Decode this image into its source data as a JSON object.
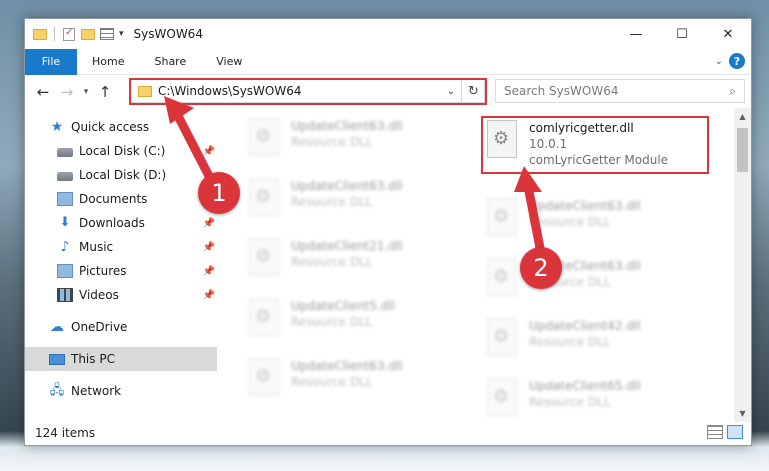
{
  "window": {
    "title": "SysWOW64",
    "controls": {
      "minimize": "—",
      "maximize": "☐",
      "close": "✕"
    }
  },
  "ribbon": {
    "tabs": [
      "File",
      "Home",
      "Share",
      "View"
    ]
  },
  "navigation": {
    "address": "C:\\Windows\\SysWOW64",
    "search_placeholder": "Search SysWOW64"
  },
  "sidebar": {
    "items": [
      {
        "label": "Quick access",
        "icon": "star-icon",
        "pinned": false
      },
      {
        "label": "Local Disk (C:)",
        "icon": "disk-icon",
        "pinned": true
      },
      {
        "label": "Local Disk (D:)",
        "icon": "disk-icon",
        "pinned": false
      },
      {
        "label": "Documents",
        "icon": "documents-icon",
        "pinned": true
      },
      {
        "label": "Downloads",
        "icon": "downloads-icon",
        "pinned": true
      },
      {
        "label": "Music",
        "icon": "music-icon",
        "pinned": true
      },
      {
        "label": "Pictures",
        "icon": "pictures-icon",
        "pinned": true
      },
      {
        "label": "Videos",
        "icon": "videos-icon",
        "pinned": true
      },
      {
        "label": "OneDrive",
        "icon": "onedrive-icon",
        "pinned": false
      },
      {
        "label": "This PC",
        "icon": "pc-icon",
        "pinned": false,
        "selected": true
      },
      {
        "label": "Network",
        "icon": "network-icon",
        "pinned": false
      }
    ]
  },
  "files": {
    "left_column": [
      {
        "name": "UpdateClient63.dll",
        "type": "Resource DLL"
      },
      {
        "name": "UpdateClient63.dll",
        "type": "Resource DLL"
      },
      {
        "name": "UpdateClient21.dll",
        "type": "Resource DLL"
      },
      {
        "name": "UpdateClient5.dll",
        "type": "Resource DLL"
      },
      {
        "name": "UpdateClient63.dll",
        "type": "Resource DLL"
      }
    ],
    "right_column": [
      {
        "name": "UpdateClient63.dll",
        "type": "Resource DLL"
      },
      {
        "name": "UpdateClient63.dll",
        "type": "Resource DLL"
      },
      {
        "name": "UpdateClient42.dll",
        "type": "Resource DLL"
      },
      {
        "name": "UpdateClient65.dll",
        "type": "Resource DLL"
      }
    ],
    "target": {
      "name": "comlyricgetter.dll",
      "version": "10.0.1",
      "description": "comLyricGetter Module"
    }
  },
  "status": {
    "item_count": "124 items"
  },
  "annotations": {
    "step1": "1",
    "step2": "2",
    "highlight_color": "#d9353b"
  },
  "colors": {
    "accent": "#1979ca",
    "selection": "#d9d9d9"
  }
}
